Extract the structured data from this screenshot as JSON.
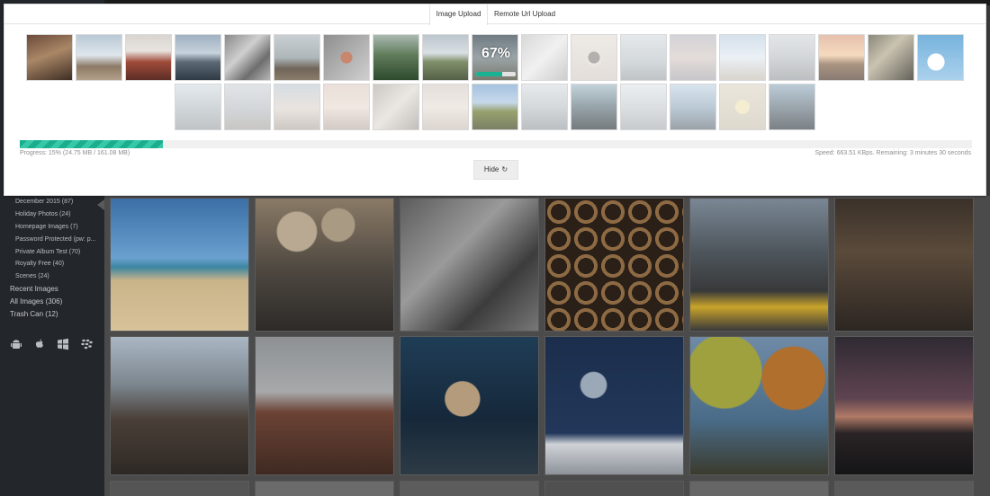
{
  "upload_dialog": {
    "tabs": [
      "Image Upload",
      "Remote Url Upload"
    ],
    "active_thumb_percent": "67%",
    "active_thumb_progress": 0.67,
    "progress_fraction": 0.15,
    "progress_text": "Progress: 15% (24.75 MB / 161.08 MB)",
    "speed_text": "Speed: 663.51 KBps. Remaining: 3 minutes 30 seconds",
    "hide_label": "Hide",
    "hide_icon": "refresh-icon"
  },
  "sidebar": {
    "items": [
      "December 2015 (87)",
      "Holiday Photos (24)",
      "Homepage Images (7)",
      "Password Protected (pw: p...",
      "Private Album Test (70)",
      "Royalty Free (40)",
      "Scenes (24)"
    ],
    "top_items": [
      "Recent Images",
      "All Images (306)",
      "Trash Can (12)"
    ],
    "platform_icons": [
      "android-icon",
      "apple-icon",
      "windows-icon",
      "blackberry-icon"
    ]
  },
  "colors": {
    "progress": "#19b394",
    "sidebar_bg": "#23262b",
    "gallery_bg": "#4b4b4b"
  }
}
